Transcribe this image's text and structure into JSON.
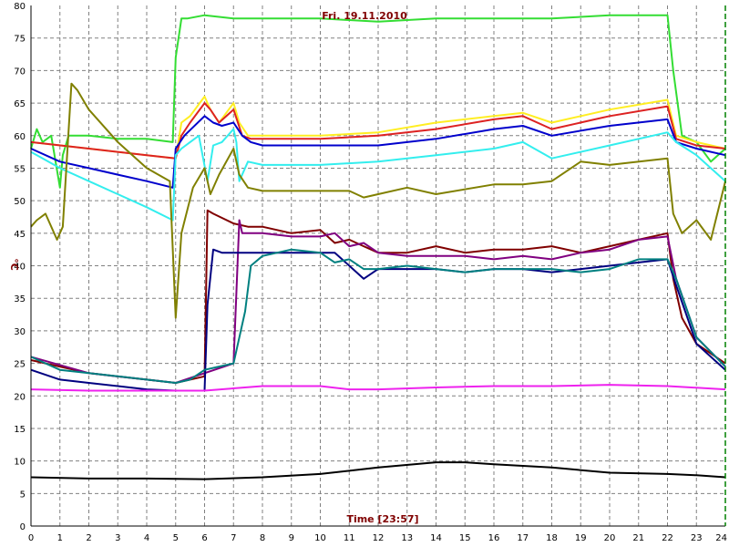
{
  "chart_data": {
    "type": "line",
    "title": "Fri. 19.11.2010",
    "xlabel": "Time [23:57]",
    "ylabel": "°C",
    "xlim": [
      0,
      24
    ],
    "ylim": [
      0,
      80
    ],
    "xticks": [
      "0",
      "1",
      "2",
      "3",
      "4",
      "5",
      "6",
      "7",
      "8",
      "9",
      "10",
      "11",
      "12",
      "13",
      "14",
      "15",
      "16",
      "17",
      "18",
      "19",
      "20",
      "21",
      "22",
      "23",
      "24"
    ],
    "yticks": [
      "0",
      "5",
      "10",
      "15",
      "20",
      "25",
      "30",
      "35",
      "40",
      "45",
      "50",
      "55",
      "60",
      "65",
      "70",
      "75",
      "80"
    ],
    "grid": true,
    "colors": {
      "grid": "#808080",
      "title": "#800000",
      "xlabel": "#800000",
      "ylabel": "#800000",
      "end_marker": "#008000"
    },
    "series": [
      {
        "color": "#33dd33",
        "x": [
          0,
          0.2,
          0.4,
          0.7,
          1.0,
          1.1,
          1.3,
          2,
          3,
          4,
          4.9,
          5.0,
          5.2,
          5.4,
          6,
          7,
          8,
          10,
          12,
          14,
          16,
          18,
          20,
          22,
          22.2,
          22.5,
          23,
          23.5,
          24
        ],
        "y": [
          58,
          61,
          59,
          60,
          52,
          57,
          60,
          60,
          59.5,
          59.5,
          59,
          72,
          78,
          78,
          78.5,
          78,
          78,
          78,
          77.5,
          78,
          78,
          78,
          78.5,
          78.5,
          70,
          60,
          59,
          56,
          58
        ]
      },
      {
        "color": "#ffee22",
        "x": [
          0,
          2,
          4,
          5.0,
          5.2,
          5.5,
          6.0,
          6.2,
          6.5,
          7,
          7.2,
          7.5,
          8,
          10,
          12,
          14,
          16,
          17,
          18,
          20,
          22,
          22.3,
          23,
          24
        ],
        "y": [
          59,
          58,
          57,
          56.5,
          62,
          63,
          66,
          64,
          62,
          65,
          62,
          60,
          60,
          60,
          60.5,
          62,
          63,
          63.5,
          62,
          64,
          65.5,
          60,
          59,
          58
        ]
      },
      {
        "color": "#dd2222",
        "x": [
          0,
          2,
          4,
          5.0,
          5.2,
          5.5,
          6,
          6.2,
          6.5,
          7,
          7.3,
          7.6,
          8,
          10,
          12,
          14,
          16,
          17,
          18,
          20,
          22,
          22.3,
          23,
          24
        ],
        "y": [
          59,
          58,
          57,
          56.5,
          60,
          62,
          65,
          64,
          62,
          64,
          60,
          59.5,
          59.5,
          59.5,
          60,
          61,
          62.5,
          63,
          61,
          63,
          64.5,
          59.5,
          58.5,
          58
        ]
      },
      {
        "color": "#0000cc",
        "x": [
          0,
          1,
          2,
          3,
          4,
          4.9,
          5.0,
          5.3,
          6,
          6.3,
          6.6,
          7,
          7.3,
          7.6,
          8,
          10,
          12,
          14,
          16,
          17,
          18,
          20,
          22,
          22.3,
          23,
          24
        ],
        "y": [
          58,
          56,
          55,
          54,
          53,
          52,
          58,
          60,
          63,
          62,
          61.5,
          62,
          60,
          59,
          58.5,
          58.5,
          58.5,
          59.5,
          61,
          61.5,
          60,
          61.5,
          62.5,
          59,
          58,
          57
        ]
      },
      {
        "color": "#33eeee",
        "x": [
          0,
          1,
          2,
          3,
          4,
          4.9,
          5.0,
          5.2,
          5.5,
          5.8,
          6.1,
          6.3,
          6.6,
          7,
          7.1,
          7.2,
          7.5,
          8,
          10,
          12,
          14,
          16,
          17,
          18,
          20,
          22,
          22.3,
          23,
          24
        ],
        "y": [
          57.5,
          55,
          53,
          51,
          49,
          47,
          57,
          58,
          59,
          60,
          53,
          58.5,
          59,
          61,
          59,
          53,
          56,
          55.5,
          55.5,
          56,
          57,
          58,
          59,
          56.5,
          58.5,
          60.5,
          59,
          57,
          53
        ]
      },
      {
        "color": "#808000",
        "x": [
          0,
          0.2,
          0.5,
          0.9,
          1.1,
          1.4,
          1.6,
          2,
          3,
          4,
          4.8,
          5.0,
          5.2,
          5.6,
          6.0,
          6.2,
          6.5,
          7,
          7.2,
          7.5,
          8,
          10,
          11,
          11.5,
          12,
          13,
          14,
          16,
          17,
          18,
          19,
          20,
          22,
          22.2,
          22.5,
          23,
          23.5,
          24
        ],
        "y": [
          46,
          47,
          48,
          44,
          46,
          68,
          67,
          64,
          59,
          55,
          53,
          32,
          45,
          52,
          55,
          51,
          54,
          58,
          54,
          52,
          51.5,
          51.5,
          51.5,
          50.5,
          51,
          52,
          51,
          52.5,
          52.5,
          53,
          56,
          55.5,
          56.5,
          48,
          45,
          47,
          44,
          53
        ]
      },
      {
        "color": "#800000",
        "x": [
          0,
          2,
          4,
          5.0,
          6.0,
          6.1,
          6.3,
          7,
          7.5,
          8,
          9,
          10,
          10.5,
          11,
          11.5,
          12,
          13,
          14,
          15,
          16,
          17,
          18,
          19,
          20,
          21,
          22,
          22.2,
          22.5,
          23,
          24
        ],
        "y": [
          25.5,
          23.5,
          22.5,
          22,
          23,
          48.5,
          48,
          46.5,
          46,
          46,
          45,
          45.5,
          43.5,
          44,
          43,
          42,
          42,
          43,
          42,
          42.5,
          42.5,
          43,
          42,
          43,
          44,
          45,
          38,
          32,
          28,
          25
        ]
      },
      {
        "color": "#800080",
        "x": [
          0,
          2,
          4,
          5.0,
          6,
          7,
          7.2,
          7.3,
          7.6,
          8,
          9,
          10,
          10.5,
          11,
          11.5,
          12,
          13,
          14,
          15,
          16,
          17,
          18,
          19,
          20,
          21,
          22,
          22.3,
          23,
          24
        ],
        "y": [
          26,
          23.5,
          22.5,
          22,
          23.5,
          25,
          47,
          45,
          45,
          45,
          44.5,
          44.5,
          45,
          43,
          43.5,
          42,
          41.5,
          41.5,
          41.5,
          41,
          41.5,
          41,
          42,
          42.5,
          44,
          44.5,
          38,
          29,
          24.5
        ]
      },
      {
        "color": "#000080",
        "x": [
          0,
          1,
          2,
          3,
          4,
          5,
          5.5,
          6,
          6.1,
          6.3,
          6.6,
          7,
          7.5,
          8,
          9,
          10,
          10.5,
          11,
          11.5,
          12,
          13,
          14,
          15,
          16,
          17,
          18,
          19,
          20,
          21,
          22,
          22.3,
          23,
          24
        ],
        "y": [
          24,
          22.5,
          22,
          21.5,
          21,
          20.8,
          20.8,
          20.8,
          34,
          42.5,
          42,
          42,
          42,
          42,
          42,
          42,
          42,
          40,
          38,
          39.5,
          39.5,
          39.5,
          39,
          39.5,
          39.5,
          39,
          39.5,
          40,
          40.5,
          41,
          37,
          28,
          24
        ]
      },
      {
        "color": "#008080",
        "x": [
          0,
          1,
          2,
          3,
          4,
          5,
          5.5,
          6,
          6.5,
          7,
          7.4,
          7.6,
          8,
          9,
          10,
          10.5,
          11,
          11.5,
          12,
          13,
          14,
          15,
          16,
          17,
          18,
          19,
          20,
          21,
          22,
          22.3,
          23,
          24
        ],
        "y": [
          26,
          24,
          23.5,
          23,
          22.5,
          22,
          22.5,
          24,
          24.5,
          25,
          33,
          40,
          41.5,
          42.5,
          42,
          40.5,
          41,
          39.5,
          39.5,
          40,
          39.5,
          39,
          39.5,
          39.5,
          39.5,
          39,
          39.5,
          41,
          41,
          38,
          29,
          24.5
        ]
      },
      {
        "color": "#ee22ee",
        "x": [
          0,
          2,
          4,
          6,
          8,
          10,
          11,
          12,
          14,
          16,
          18,
          20,
          22,
          24
        ],
        "y": [
          21,
          20.8,
          20.8,
          20.8,
          21.5,
          21.5,
          21,
          21,
          21.3,
          21.5,
          21.5,
          21.7,
          21.5,
          21
        ]
      },
      {
        "color": "#000000",
        "x": [
          0,
          2,
          4,
          6,
          8,
          10,
          12,
          14,
          15,
          16,
          18,
          20,
          22,
          23,
          24
        ],
        "y": [
          7.5,
          7.3,
          7.3,
          7.2,
          7.5,
          8,
          9,
          9.8,
          9.8,
          9.5,
          9,
          8.2,
          8,
          7.8,
          7.5
        ]
      }
    ]
  }
}
